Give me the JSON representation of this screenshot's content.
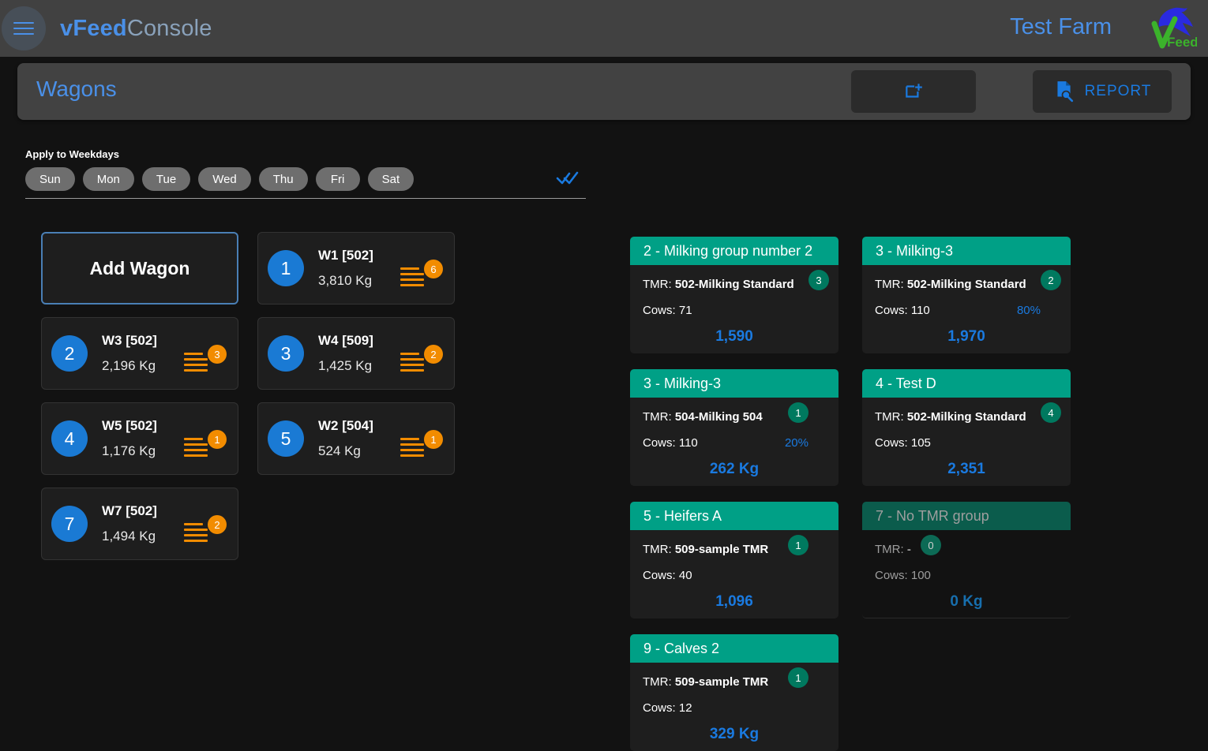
{
  "appbar": {
    "menu_icon": "hamburger-menu-icon",
    "brand_primary": "vFeed",
    "brand_secondary": "Console",
    "farm_name": "Test Farm",
    "logo_text": "Feed",
    "logo_icon": "vfeed-cow-logo",
    "colors": {
      "accent_blue": "#4a90e8",
      "bar_bg": "#414141"
    }
  },
  "toolbar": {
    "title": "Wagons",
    "add_button": {
      "icon": "add-to-box-icon",
      "label": ""
    },
    "report_button": {
      "icon": "document-search-icon",
      "label": "REPORT"
    }
  },
  "weekdays": {
    "label": "Apply to Weekdays",
    "days": [
      "Sun",
      "Mon",
      "Tue",
      "Wed",
      "Thu",
      "Fri",
      "Sat"
    ],
    "apply_all_icon": "double-check-icon"
  },
  "wagons_panel": {
    "add_wagon_label": "Add Wagon",
    "stack_icon": "stacked-layers-icon",
    "items": [
      {
        "num": "1",
        "name": "W1 [502]",
        "weight": "3,810 Kg",
        "badge": "6"
      },
      {
        "num": "2",
        "name": "W3 [502]",
        "weight": "2,196 Kg",
        "badge": "3"
      },
      {
        "num": "3",
        "name": "W4 [509]",
        "weight": "1,425 Kg",
        "badge": "2"
      },
      {
        "num": "4",
        "name": "W5 [502]",
        "weight": "1,176 Kg",
        "badge": "1"
      },
      {
        "num": "5",
        "name": "W2 [504]",
        "weight": "524 Kg",
        "badge": "1"
      },
      {
        "num": "7",
        "name": "W7 [502]",
        "weight": "1,494 Kg",
        "badge": "2"
      }
    ]
  },
  "groups_panel": {
    "tmr_label": "TMR:",
    "cows_label": "Cows:",
    "items": [
      {
        "title": "2 - Milking group number 2",
        "tmr": "502-Milking Standard",
        "cows": "71",
        "percent": "",
        "total": "1,590",
        "badge": "3",
        "disabled": false
      },
      {
        "title": "3 - Milking-3",
        "tmr": "502-Milking Standard",
        "cows": "110",
        "percent": "80%",
        "total": "1,970",
        "badge": "2",
        "disabled": false
      },
      {
        "title": "3 - Milking-3",
        "tmr": "504-Milking 504",
        "cows": "110",
        "percent": "20%",
        "total": "262 Kg",
        "badge": "1",
        "disabled": false
      },
      {
        "title": "4 - Test D",
        "tmr": "502-Milking Standard",
        "cows": "105",
        "percent": "",
        "total": "2,351",
        "badge": "4",
        "disabled": false
      },
      {
        "title": "5 - Heifers A",
        "tmr": "509-sample TMR",
        "cows": "40",
        "percent": "",
        "total": "1,096",
        "badge": "1",
        "disabled": false
      },
      {
        "title": "7 - No TMR group",
        "tmr": "-",
        "cows": "100",
        "percent": "",
        "total": "0 Kg",
        "badge": "0",
        "disabled": true
      },
      {
        "title": "9 - Calves 2",
        "tmr": "509-sample TMR",
        "cows": "12",
        "percent": "",
        "total": "329 Kg",
        "badge": "1",
        "disabled": false
      }
    ]
  },
  "colors": {
    "blue": "#1a7ae0",
    "teal": "#00a086",
    "orange": "#f28c00",
    "page_bg": "#121212"
  }
}
